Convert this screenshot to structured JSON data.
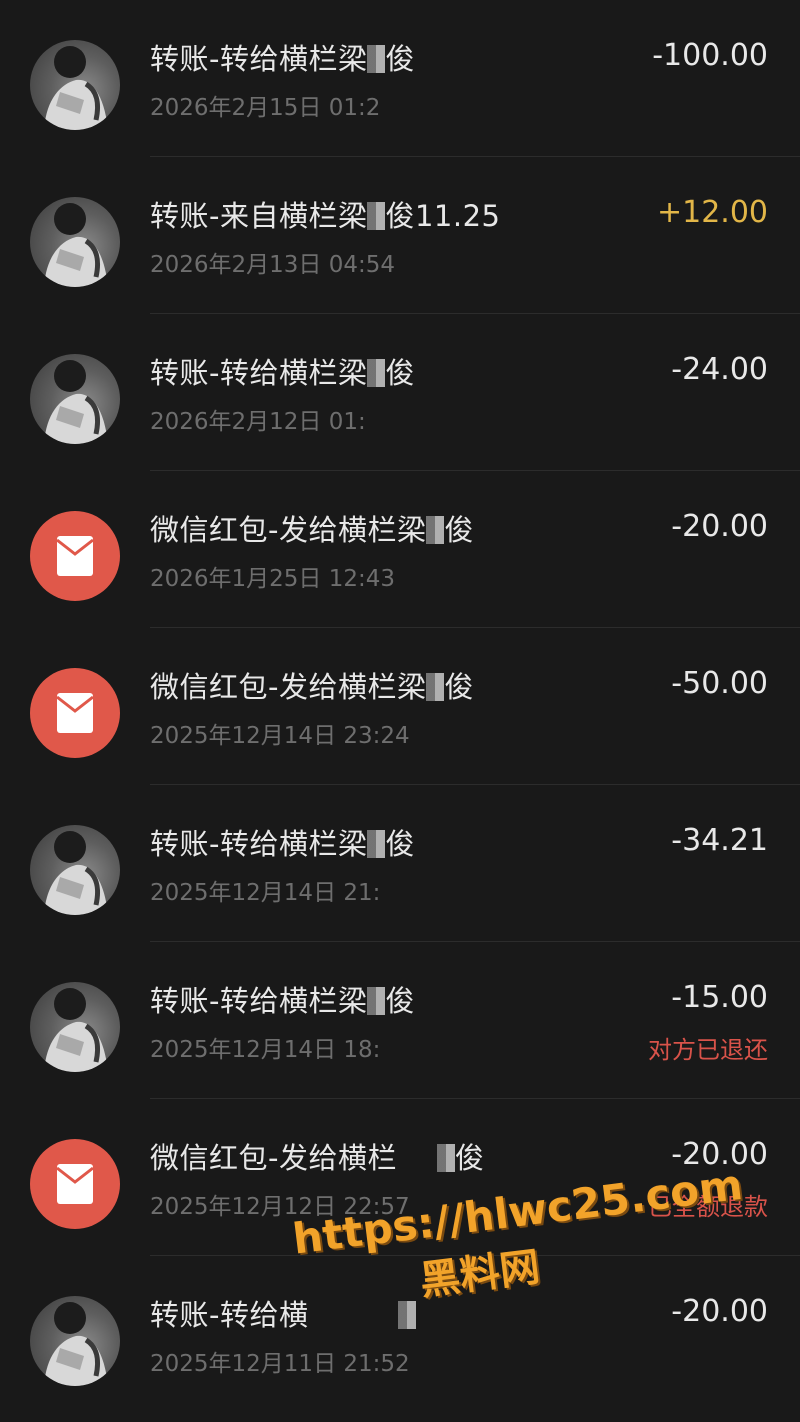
{
  "transactions": [
    {
      "type": "transfer",
      "title": "转账-转给横栏梁",
      "title_suffix": "俊",
      "time": "2026年2月15日 01:2",
      "amount": "-100.00",
      "income": false,
      "status": ""
    },
    {
      "type": "transfer",
      "title": "转账-来自横栏梁",
      "title_suffix": "俊11.25",
      "time": "2026年2月13日 04:54",
      "amount": "+12.00",
      "income": true,
      "status": ""
    },
    {
      "type": "transfer",
      "title": "转账-转给横栏梁",
      "title_suffix": "俊",
      "time": "2026年2月12日 01:",
      "amount": "-24.00",
      "income": false,
      "status": ""
    },
    {
      "type": "redpacket",
      "title": "微信红包-发给横栏梁",
      "title_suffix": "俊",
      "time": "2026年1月25日 12:43",
      "amount": "-20.00",
      "income": false,
      "status": ""
    },
    {
      "type": "redpacket",
      "title": "微信红包-发给横栏梁",
      "title_suffix": "俊",
      "time": "2025年12月14日 23:24",
      "amount": "-50.00",
      "income": false,
      "status": ""
    },
    {
      "type": "transfer",
      "title": "转账-转给横栏梁",
      "title_suffix": "俊",
      "time": "2025年12月14日 21:",
      "amount": "-34.21",
      "income": false,
      "status": ""
    },
    {
      "type": "transfer",
      "title": "转账-转给横栏梁",
      "title_suffix": "俊",
      "time": "2025年12月14日 18:",
      "amount": "-15.00",
      "income": false,
      "status": "对方已退还"
    },
    {
      "type": "redpacket",
      "title": "微信红包-发给横栏",
      "title_suffix": "俊",
      "time": "2025年12月12日 22:57",
      "amount": "-20.00",
      "income": false,
      "status": "已全额退款"
    },
    {
      "type": "transfer",
      "title": "转账-转给横",
      "title_suffix": "",
      "time": "2025年12月11日 21:52",
      "amount": "-20.00",
      "income": false,
      "status": ""
    }
  ],
  "watermark": {
    "url": "https://hlwc25.com",
    "brand": "黑料网"
  },
  "colors": {
    "background": "#191919",
    "income": "#e2b648",
    "refund_status": "#d9534a",
    "redpacket": "#e0584a"
  }
}
